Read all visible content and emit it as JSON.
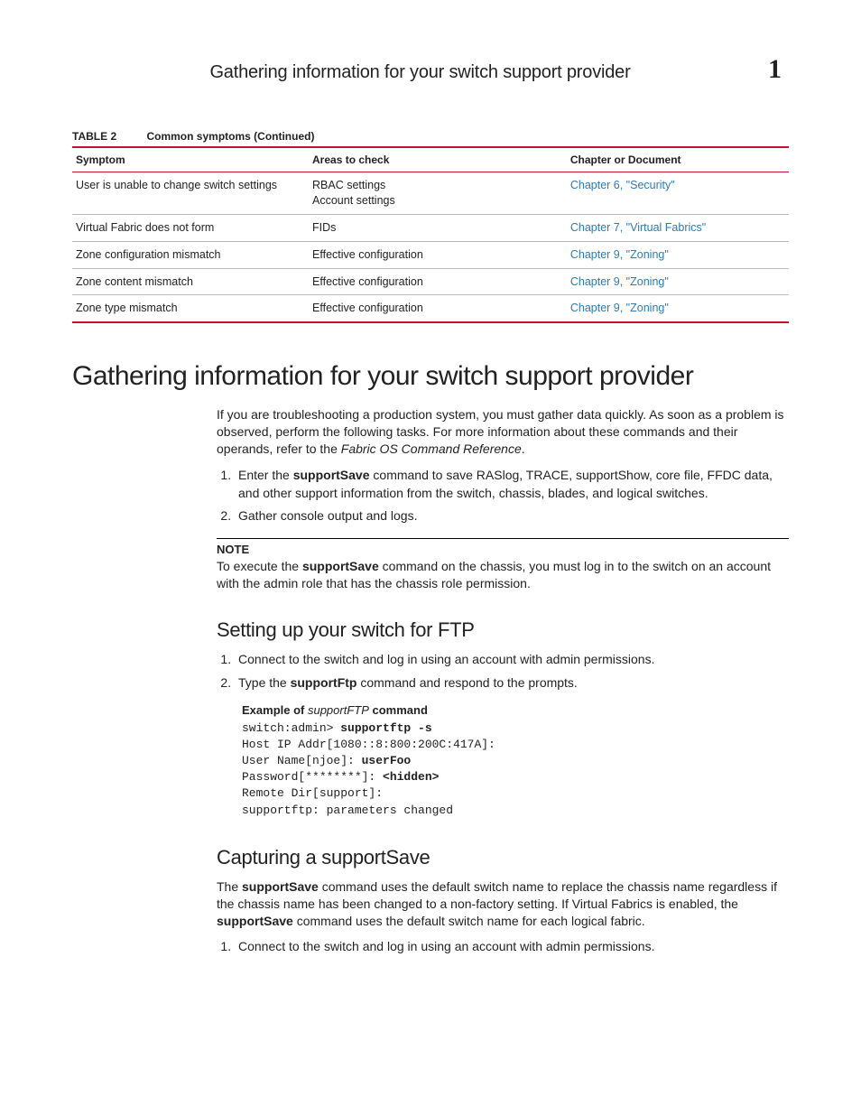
{
  "header": {
    "running_title": "Gathering information for your switch support provider",
    "chapter_number": "1"
  },
  "table": {
    "label": "TABLE 2",
    "title": "Common symptoms  (Continued)",
    "columns": [
      "Symptom",
      "Areas to check",
      "Chapter or Document"
    ],
    "rows": [
      {
        "symptom": "User is unable to change switch settings",
        "areas": "RBAC settings\nAccount settings",
        "chapter": "Chapter 6, \"Security\""
      },
      {
        "symptom": "Virtual Fabric does not form",
        "areas": "FIDs",
        "chapter": "Chapter 7, \"Virtual Fabrics\""
      },
      {
        "symptom": "Zone configuration mismatch",
        "areas": "Effective configuration",
        "chapter": "Chapter 9, \"Zoning\""
      },
      {
        "symptom": "Zone content mismatch",
        "areas": "Effective configuration",
        "chapter": "Chapter 9, \"Zoning\""
      },
      {
        "symptom": "Zone type mismatch",
        "areas": "Effective configuration",
        "chapter": "Chapter 9, \"Zoning\""
      }
    ]
  },
  "section": {
    "heading": "Gathering information for your switch support provider",
    "intro_pre": "If you are troubleshooting a production system, you must gather data quickly. As soon as a problem is observed, perform the following tasks. For more information about these commands and their operands, refer to the ",
    "intro_italic": "Fabric OS Command Reference",
    "intro_post": ".",
    "steps": {
      "s1_pre": "Enter the ",
      "s1_bold": "supportSave",
      "s1_post": " command to save RASlog, TRACE, supportShow, core file, FFDC data, and other support information from the switch, chassis, blades, and logical switches.",
      "s2": "Gather console output and logs."
    },
    "note": {
      "label": "NOTE",
      "pre": "To execute the ",
      "bold": "supportSave",
      "post": " command on the chassis, you must log in to the switch on an account with the admin role that has the chassis role permission."
    }
  },
  "ftp": {
    "heading": "Setting up your switch for FTP",
    "steps": {
      "s1": "Connect to the switch and log in using an account with admin permissions.",
      "s2_pre": "Type the ",
      "s2_bold": "supportFtp",
      "s2_post": " command and respond to the prompts."
    },
    "example_label_pre": "Example  of ",
    "example_label_italic": "supportFTP",
    "example_label_post": " command",
    "code": {
      "l1a": "switch:admin> ",
      "l1b": "supportftp -s",
      "l2": "Host IP Addr[1080::8:800:200C:417A]:",
      "l3a": "User Name[njoe]: ",
      "l3b": "userFoo",
      "l4a": "Password[********]: ",
      "l4b": "<hidden>",
      "l5": "Remote Dir[support]:",
      "l6": "supportftp: parameters changed"
    }
  },
  "capture": {
    "heading": "Capturing a supportSave",
    "p1_pre": "The ",
    "p1_b1": "supportSave",
    "p1_mid": " command uses the default switch name to replace the chassis name regardless if the chassis name has been changed to a non-factory setting. If Virtual Fabrics is enabled, the ",
    "p1_b2": "supportSave",
    "p1_post": " command uses the default switch name for each logical fabric.",
    "steps": {
      "s1": "Connect to the switch and log in using an account with admin permissions."
    }
  }
}
